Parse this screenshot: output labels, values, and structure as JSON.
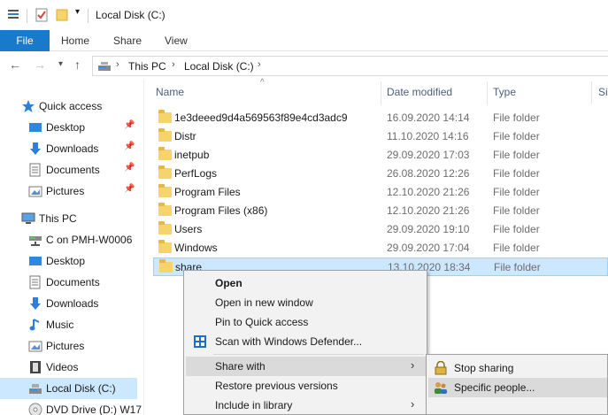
{
  "window": {
    "title": "Local Disk (C:)"
  },
  "ribbon": {
    "tabs": [
      "File",
      "Home",
      "Share",
      "View"
    ]
  },
  "address": {
    "crumbs": [
      "This PC",
      "Local Disk (C:)"
    ]
  },
  "sidebar": {
    "items": [
      {
        "label": "Quick access",
        "icon": "star-icon",
        "pinned": false
      },
      {
        "label": "Desktop",
        "icon": "desktop-icon",
        "pinned": true
      },
      {
        "label": "Downloads",
        "icon": "download-icon",
        "pinned": true
      },
      {
        "label": "Documents",
        "icon": "documents-icon",
        "pinned": true
      },
      {
        "label": "Pictures",
        "icon": "pictures-icon",
        "pinned": true
      },
      {
        "label": "This PC",
        "icon": "computer-icon",
        "pinned": false
      },
      {
        "label": "C on PMH-W0006",
        "icon": "network-drive-icon",
        "pinned": false
      },
      {
        "label": "Desktop",
        "icon": "desktop-icon",
        "pinned": false
      },
      {
        "label": "Documents",
        "icon": "documents-icon",
        "pinned": false
      },
      {
        "label": "Downloads",
        "icon": "download-icon",
        "pinned": false
      },
      {
        "label": "Music",
        "icon": "music-icon",
        "pinned": false
      },
      {
        "label": "Pictures",
        "icon": "pictures-icon",
        "pinned": false
      },
      {
        "label": "Videos",
        "icon": "videos-icon",
        "pinned": false
      },
      {
        "label": "Local Disk (C:)",
        "icon": "drive-icon",
        "pinned": false
      },
      {
        "label": "DVD Drive (D:) W17",
        "icon": "dvd-icon",
        "pinned": false
      }
    ]
  },
  "filelist": {
    "columns": {
      "name": "Name",
      "date": "Date modified",
      "type": "Type",
      "size": "Si"
    },
    "rows": [
      {
        "name": "1e3deeed9d4a569563f89e4cd3adc9",
        "date": "16.09.2020 14:14",
        "type": "File folder"
      },
      {
        "name": "Distr",
        "date": "11.10.2020 14:16",
        "type": "File folder"
      },
      {
        "name": "inetpub",
        "date": "29.09.2020 17:03",
        "type": "File folder"
      },
      {
        "name": "PerfLogs",
        "date": "26.08.2020 12:26",
        "type": "File folder"
      },
      {
        "name": "Program Files",
        "date": "12.10.2020 21:26",
        "type": "File folder"
      },
      {
        "name": "Program Files (x86)",
        "date": "12.10.2020 21:26",
        "type": "File folder"
      },
      {
        "name": "Users",
        "date": "29.09.2020 19:10",
        "type": "File folder"
      },
      {
        "name": "Windows",
        "date": "29.09.2020 17:04",
        "type": "File folder"
      },
      {
        "name": "share",
        "date": "13.10.2020 18:34",
        "type": "File folder"
      }
    ]
  },
  "context_menu": {
    "items": [
      {
        "label": "Open",
        "bold": true
      },
      {
        "label": "Open in new window"
      },
      {
        "label": "Pin to Quick access"
      },
      {
        "label": "Scan with Windows Defender..."
      },
      {
        "label": "Share with",
        "submenu": true
      },
      {
        "label": "Restore previous versions"
      },
      {
        "label": "Include in library",
        "submenu": true
      }
    ]
  },
  "share_submenu": {
    "items": [
      {
        "label": "Stop sharing",
        "icon": "lock-icon"
      },
      {
        "label": "Specific people...",
        "icon": "people-icon"
      }
    ]
  },
  "colors": {
    "accent": "#1979ca",
    "selection": "#cce8ff",
    "folder": "#f7d36b"
  }
}
